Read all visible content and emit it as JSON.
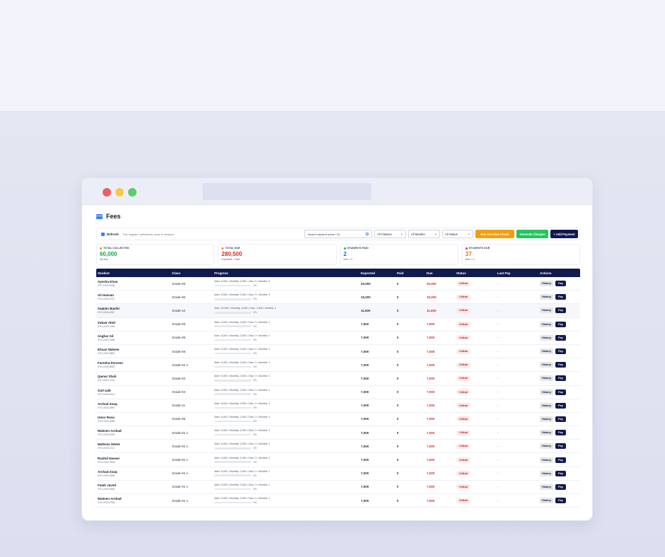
{
  "window": {
    "title": ""
  },
  "page": {
    "title": "Fees"
  },
  "toolbar": {
    "refresh_label": "Refresh",
    "hint": "Fee register, collections, dues & receipts",
    "search_placeholder": "Search student name / ID...",
    "class_filter": "All Classes",
    "month_filter": "All Months",
    "status_filter": "All Status",
    "overdue_button": "Run Overdue Check",
    "generate_button": "Generate Charges",
    "add_payment_button": "+ Add Payment"
  },
  "cards": [
    {
      "label": "TOTAL COLLECTED",
      "value": "60,000",
      "sub": "All time",
      "color": "#16a34a",
      "icon_color": "#f59e0b"
    },
    {
      "label": "TOTAL DUE",
      "value": "280,500",
      "sub": "Expected - Paid",
      "color": "#dc2626",
      "icon_color": "#f59e0b"
    },
    {
      "label": "STUDENTS PAID",
      "value": "2",
      "sub": "Due = 0",
      "color": "#2563eb",
      "icon_color": "#22c55e"
    },
    {
      "label": "STUDENTS DUE",
      "value": "37",
      "sub": "Due > 0",
      "color": "#d97706",
      "icon_color": "#ef4444"
    }
  ],
  "table": {
    "columns": [
      "Student",
      "Class",
      "Progress",
      "Expected",
      "Paid",
      "Due",
      "Status",
      "Last Pay",
      "Actions"
    ],
    "history_label": "History",
    "pay_label": "Pay",
    "rows": [
      {
        "name": "Ayesha Khan",
        "id": "STD-2025-4238",
        "class": "Grade-06",
        "progress": "Adm: 5,000 • Monthly: 2,000 • Disc: 0 • Months: 5",
        "pct": "0%",
        "fill": 0,
        "expected": "20,000",
        "paid": "0",
        "due": "20,000",
        "status": "Critical",
        "last_pay": "-"
      },
      {
        "name": "Ali Hassan",
        "id": "STD-2025-8731",
        "class": "Grade-06",
        "progress": "Adm: 5,000 • Monthly: 2,000 • Disc: 0 • Months: 5",
        "pct": "0%",
        "fill": 0,
        "expected": "15,000",
        "paid": "0",
        "due": "15,000",
        "status": "Critical",
        "last_pay": "-"
      },
      {
        "name": "Saqlain Bashir",
        "id": "STD-2025-4987",
        "class": "Grade-12",
        "progress": "Adm: 10,000 • Monthly: 4,000 • Disc: 2,500 • Months: 1",
        "pct": "0%",
        "fill": 0,
        "expected": "11,500",
        "paid": "0",
        "due": "11,500",
        "status": "Critical",
        "last_pay": "-"
      },
      {
        "name": "Zubair Abid",
        "id": "STD-2025-7049",
        "class": "Grade-05",
        "progress": "Adm: 5,000 • Monthly: 2,500 • Disc: 0 • Months: 1",
        "pct": "0%",
        "fill": 0,
        "expected": "7,500",
        "paid": "0",
        "due": "7,500",
        "status": "Critical",
        "last_pay": "-"
      },
      {
        "name": "Asghar Ali",
        "id": "STD-2025-2288",
        "class": "Grade-09",
        "progress": "Adm: 5,000 • Monthly: 2,000 • Disc: 0 • Months: 1",
        "pct": "0%",
        "fill": 0,
        "expected": "7,000",
        "paid": "0",
        "due": "7,000",
        "status": "Critical",
        "last_pay": "-"
      },
      {
        "name": "Ehsan Waheer",
        "id": "STD-2025-3882",
        "class": "Grade-08",
        "progress": "Adm: 5,000 • Monthly: 2,000 • Disc: 0 • Months: 1",
        "pct": "0%",
        "fill": 0,
        "expected": "7,000",
        "paid": "0",
        "due": "7,000",
        "status": "Critical",
        "last_pay": "-"
      },
      {
        "name": "Fareeha Perveen",
        "id": "STD-2025-8630",
        "class": "Grade-01 A",
        "progress": "Adm: 5,000 • Monthly: 2,000 • Disc: 0 • Months: 1",
        "pct": "0%",
        "fill": 0,
        "expected": "7,000",
        "paid": "0",
        "due": "7,000",
        "status": "Critical",
        "last_pay": "-"
      },
      {
        "name": "Qamar Shah",
        "id": "STD-2025-7224",
        "class": "Grade-02",
        "progress": "Adm: 5,000 • Monthly: 2,000 • Disc: 0 • Months: 1",
        "pct": "0%",
        "fill": 0,
        "expected": "7,000",
        "paid": "0",
        "due": "7,000",
        "status": "Critical",
        "last_pay": "-"
      },
      {
        "name": "Gull zaib",
        "id": "STD-2025-6121",
        "class": "Grade-03",
        "progress": "Adm: 5,000 • Monthly: 2,000 • Disc: 0 • Months: 1",
        "pct": "0%",
        "fill": 0,
        "expected": "7,000",
        "paid": "0",
        "due": "7,000",
        "status": "Critical",
        "last_pay": "-"
      },
      {
        "name": "Arshad Zoaq",
        "id": "STD-2025-3590",
        "class": "Grade-11",
        "progress": "Adm: 5,000 • Monthly: 2,000 • Disc: 0 • Months: 1",
        "pct": "0%",
        "fill": 0,
        "expected": "7,000",
        "paid": "0",
        "due": "7,000",
        "status": "Critical",
        "last_pay": "-"
      },
      {
        "name": "Umar Rana",
        "id": "STD-2025-4966",
        "class": "Grade-06",
        "progress": "Adm: 5,000 • Monthly: 2,000 • Disc: 0 • Months: 1",
        "pct": "0%",
        "fill": 0,
        "expected": "7,000",
        "paid": "0",
        "due": "7,000",
        "status": "Critical",
        "last_pay": "-"
      },
      {
        "name": "Mubeen Arshad",
        "id": "STD-2025-3249",
        "class": "Grade-01 A",
        "progress": "Adm: 5,000 • Monthly: 2,000 • Disc: 0 • Months: 1",
        "pct": "0%",
        "fill": 0,
        "expected": "7,000",
        "paid": "0",
        "due": "7,000",
        "status": "Critical",
        "last_pay": "-"
      },
      {
        "name": "Mafeeza SHAH",
        "id": "STD-2025-4721",
        "class": "Grade-01 A",
        "progress": "Adm: 5,000 • Monthly: 2,000 • Disc: 0 • Months: 1",
        "pct": "0%",
        "fill": 0,
        "expected": "7,000",
        "paid": "0",
        "due": "7,000",
        "status": "Critical",
        "last_pay": "-"
      },
      {
        "name": "Rashid Naseer",
        "id": "STD-2025-7828",
        "class": "Grade-01 A",
        "progress": "Adm: 5,000 • Monthly: 2,000 • Disc: 0 • Months: 1",
        "pct": "0%",
        "fill": 0,
        "expected": "7,000",
        "paid": "0",
        "due": "7,000",
        "status": "Critical",
        "last_pay": "-"
      },
      {
        "name": "Arshad Zoaq",
        "id": "STD-2025-3848",
        "class": "Grade-01 A",
        "progress": "Adm: 5,000 • Monthly: 2,000 • Disc: 0 • Months: 1",
        "pct": "0%",
        "fill": 0,
        "expected": "7,000",
        "paid": "0",
        "due": "7,000",
        "status": "Critical",
        "last_pay": "-"
      },
      {
        "name": "Fatah Javed",
        "id": "STD-2025-9468",
        "class": "Grade-01 A",
        "progress": "Adm: 5,000 • Monthly: 2,000 • Disc: 0 • Months: 1",
        "pct": "0%",
        "fill": 0,
        "expected": "7,000",
        "paid": "0",
        "due": "7,000",
        "status": "Critical",
        "last_pay": "-"
      },
      {
        "name": "Mubeen Arshad",
        "id": "STD-2025-4765",
        "class": "Grade-01 A",
        "progress": "Adm: 5,000 • Monthly: 2,000 • Disc: 0 • Months: 1",
        "pct": "0%",
        "fill": 0,
        "expected": "7,000",
        "paid": "0",
        "due": "7,000",
        "status": "Critical",
        "last_pay": "-"
      }
    ]
  }
}
